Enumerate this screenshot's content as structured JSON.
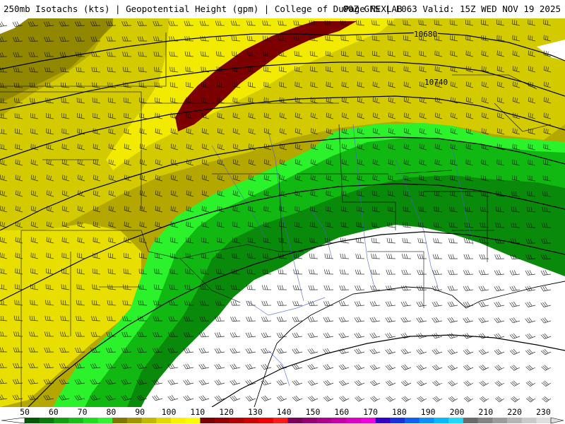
{
  "header": {
    "title": "250mb Isotachs (kts)",
    "subtitle": "Geopotential Height (gpm)",
    "credit": "College of DuPage NEXLAB",
    "model": "00Z GFS",
    "forecast_hour": "F063",
    "valid": "Valid: 15Z WED NOV 19 2025",
    "separator": "|"
  },
  "map": {
    "contour_labels": [
      "10680",
      "10740"
    ],
    "colors": {
      "white": "#ffffff",
      "green_light": "#2cf22c",
      "green_mid": "#12b812",
      "green_dark": "#0a8a0a",
      "olive_dark": "#8c8200",
      "olive": "#b4a700",
      "yellow_dark": "#d3ca00",
      "yellow": "#f2ea00",
      "maroon": "#7d0000",
      "border": "#000000",
      "river": "#4a5ad8"
    }
  },
  "legend": {
    "labels": [
      "50",
      "60",
      "70",
      "80",
      "90",
      "100",
      "110",
      "120",
      "130",
      "140",
      "150",
      "160",
      "170",
      "180",
      "190",
      "200",
      "210",
      "220",
      "230"
    ],
    "colors": [
      "#035803",
      "#0a7a0a",
      "#11a011",
      "#17be17",
      "#1ede1e",
      "#30f230",
      "#807700",
      "#a09500",
      "#c2b800",
      "#e2d800",
      "#f8f000",
      "#fcfc00",
      "#7a0000",
      "#960000",
      "#b40000",
      "#d00000",
      "#ec0000",
      "#ff1a1a",
      "#7a0058",
      "#940070",
      "#ae008c",
      "#c400a4",
      "#dc00c0",
      "#f000dc",
      "#3400c8",
      "#1830e0",
      "#1060f0",
      "#0c90f8",
      "#08b8fa",
      "#20d8fa",
      "#6a6a6a",
      "#848484",
      "#9c9c9c",
      "#b4b4b4",
      "#cacaca",
      "#dedede"
    ]
  }
}
